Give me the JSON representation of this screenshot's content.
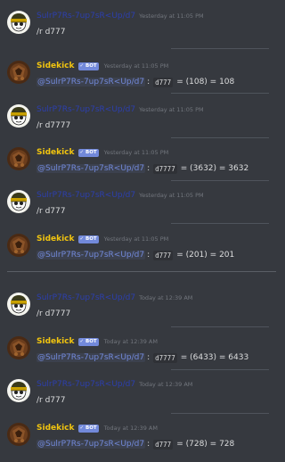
{
  "colors": {
    "background": "#36393f",
    "user_name": "#2c3fae",
    "bot_name": "#f1c40f",
    "bot_tag": "#7289da",
    "mention": "#7289da",
    "timestamp": "#72767d"
  },
  "user_name": "SulrP7Rs-7up7sR<Up/d7",
  "bot_name": "Sidekick",
  "bot_tag": "BOT",
  "mention": "@SulrP7Rs-7up7sR<Up/d7",
  "separator": ":",
  "messages": [
    {
      "author": "SulrP7Rs-7up7sR<Up/d7",
      "time": "Yesterday at 11:05 PM",
      "text": "/r d777"
    },
    {
      "author": "Sidekick",
      "time": "Yesterday at 11:05 PM",
      "dice": "d777",
      "result": "= (108) = 108"
    },
    {
      "author": "SulrP7Rs-7up7sR<Up/d7",
      "time": "Yesterday at 11:05 PM",
      "text": "/r d7777"
    },
    {
      "author": "Sidekick",
      "time": "Yesterday at 11:05 PM",
      "dice": "d7777",
      "result": "= (3632) = 3632"
    },
    {
      "author": "SulrP7Rs-7up7sR<Up/d7",
      "time": "Yesterday at 11:05 PM",
      "text": "/r d777"
    },
    {
      "author": "Sidekick",
      "time": "Yesterday at 11:05 PM",
      "dice": "d777",
      "result": "= (201) = 201"
    },
    {
      "author": "SulrP7Rs-7up7sR<Up/d7",
      "time": "Today at 12:39 AM",
      "text": "/r d7777"
    },
    {
      "author": "Sidekick",
      "time": "Today at 12:39 AM",
      "dice": "d7777",
      "result": "= (6433) = 6433"
    },
    {
      "author": "SulrP7Rs-7up7sR<Up/d7",
      "time": "Today at 12:39 AM",
      "text": "/r d777"
    },
    {
      "author": "Sidekick",
      "time": "Today at 12:39 AM",
      "dice": "d777",
      "result": "= (728) = 728"
    }
  ]
}
